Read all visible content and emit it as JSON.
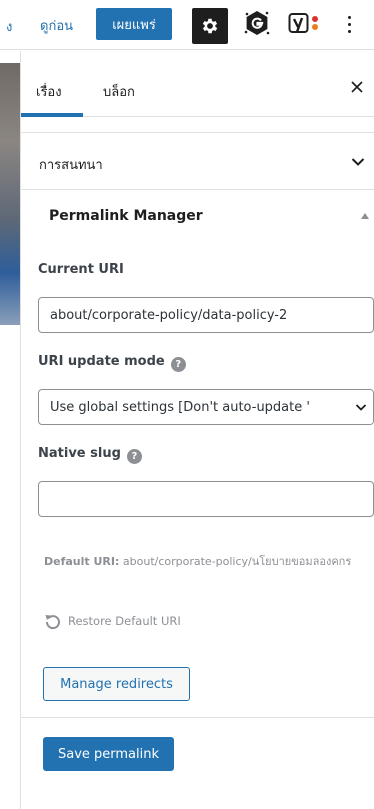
{
  "toolbar": {
    "cut_label": "ง",
    "preview_label": "ดูก่อน",
    "publish_label": "เผยแพร่",
    "settings_icon": "gear-icon",
    "plugin_icon": "g-logo-icon",
    "yoast_icon": "yoast-icon",
    "more_icon": "more-vertical-icon"
  },
  "sidebar": {
    "tabs": [
      {
        "label": "เรื่อง",
        "active": true
      },
      {
        "label": "บล็อก",
        "active": false
      }
    ],
    "close_icon": "close-icon",
    "discussion_title": "การสนทนา",
    "permalink": {
      "title": "Permalink Manager",
      "current_uri_label": "Current URI",
      "current_uri_value": "about/corporate-policy/data-policy-2",
      "uri_update_mode_label": "URI update mode",
      "uri_update_mode_value": "Use global settings [Don't auto-update '",
      "native_slug_label": "Native slug",
      "native_slug_value": "",
      "help_glyph": "?",
      "default_uri_label": "Default URI:",
      "default_uri_value": "about/corporate-policy/นโยบายขอมลองคกร",
      "restore_label": "Restore Default URI",
      "manage_redirects_label": "Manage redirects",
      "save_label": "Save permalink"
    }
  },
  "colors": {
    "accent": "#2271b1",
    "muted": "#8c8f94",
    "dark": "#1e1e1e"
  }
}
